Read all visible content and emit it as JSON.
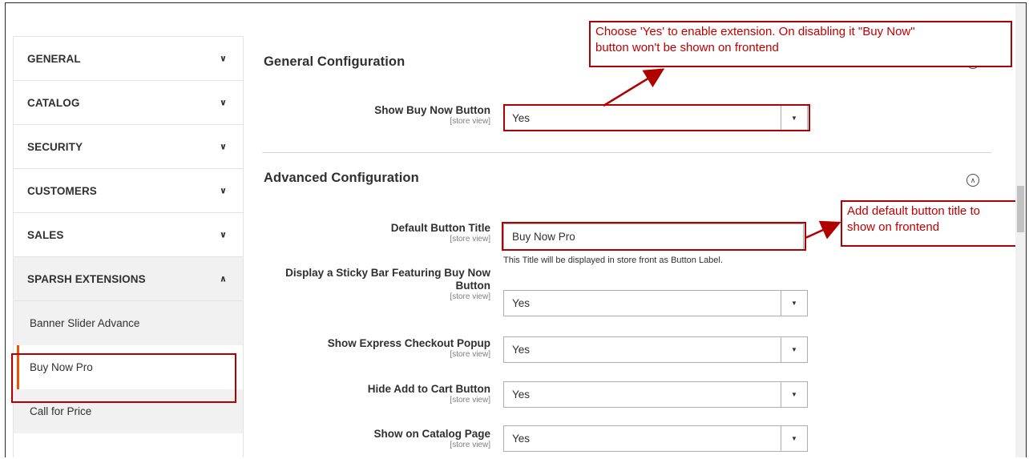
{
  "sidebar": {
    "sections": [
      {
        "label": "GENERAL",
        "chevron": "chevron-down-icon"
      },
      {
        "label": "CATALOG",
        "chevron": "chevron-down-icon"
      },
      {
        "label": "SECURITY",
        "chevron": "chevron-down-icon"
      },
      {
        "label": "CUSTOMERS",
        "chevron": "chevron-down-icon"
      },
      {
        "label": "SALES",
        "chevron": "chevron-down-icon"
      },
      {
        "label": "SPARSH EXTENSIONS",
        "chevron": "chevron-up-icon"
      }
    ],
    "sub_items": [
      {
        "label": "Banner Slider Advance"
      },
      {
        "label": "Buy Now Pro",
        "active": true
      },
      {
        "label": "Call for Price"
      }
    ]
  },
  "general": {
    "title": "General Configuration",
    "show_buy_now": {
      "label": "Show Buy Now Button",
      "scope": "[store view]",
      "value": "Yes"
    }
  },
  "advanced": {
    "title": "Advanced Configuration",
    "default_title": {
      "label": "Default Button Title",
      "scope": "[store view]",
      "value": "Buy Now Pro",
      "note": "This Title will be displayed in store front as Button Label."
    },
    "sticky_bar": {
      "label_line1": "Display a Sticky Bar Featuring Buy Now",
      "label_line2": "Button",
      "scope": "[store view]",
      "value": "Yes"
    },
    "express_checkout": {
      "label": "Show Express Checkout Popup",
      "scope": "[store view]",
      "value": "Yes"
    },
    "hide_cart": {
      "label": "Hide Add to Cart Button",
      "scope": "[store view]",
      "value": "Yes"
    },
    "catalog_page": {
      "label": "Show on Catalog Page",
      "scope": "[store view]",
      "value": "Yes"
    }
  },
  "annotations": {
    "callout1_line1": "Choose 'Yes' to enable extension. On disabling it \"Buy Now\"",
    "callout1_line2": "button won't be shown on frontend",
    "callout2_line1": "Add default button title to",
    "callout2_line2": "show on frontend"
  },
  "colors": {
    "annotation": "#c00000",
    "active_marker": "#eb5202"
  }
}
